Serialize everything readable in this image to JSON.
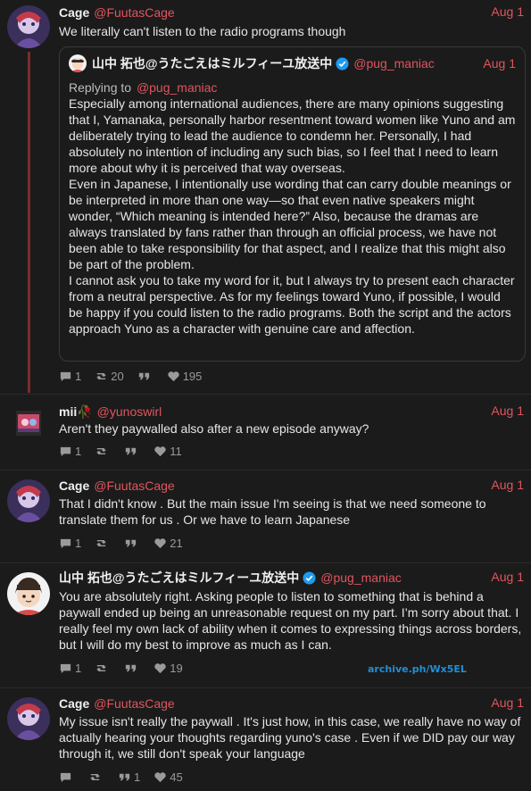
{
  "tweets": [
    {
      "name": "Cage",
      "handle": "@FuutasCage",
      "date": "Aug 1",
      "text": "We literally can't listen to the radio programs though",
      "stats": {
        "replies": "1",
        "retweets": "20",
        "quotes": "",
        "likes": "195"
      },
      "quote": {
        "name": "山中 拓也@うたごえはミルフィーユ放送中",
        "handle": "@pug_maniac",
        "date": "Aug 1",
        "replying_prefix": "Replying to",
        "replying_handle": "@pug_maniac",
        "paragraphs": [
          "Especially among international audiences, there are many opinions suggesting that I, Yamanaka, personally harbor resentment toward women like Yuno and am deliberately trying to lead the audience to condemn her. Personally, I had absolutely no intention of including any such bias, so I feel that I need to learn more about why it is perceived that way overseas.",
          "Even in Japanese, I intentionally use wording that can carry double meanings or be interpreted in more than one way—so that even native speakers might wonder, “Which meaning is intended here?” Also, because the dramas are always translated by fans rather than through an official process, we have not been able to take responsibility for that aspect, and I realize that this might also be part of the problem.",
          "I cannot ask you to take my word for it, but I always try to present each character from a neutral perspective. As for my feelings toward Yuno, if possible, I would be happy if you could listen to the radio programs. Both the script and the actors approach Yuno as a character with genuine care and affection."
        ]
      }
    },
    {
      "name": "mii🥀",
      "handle": "@yunoswirl",
      "date": "Aug 1",
      "text": "Aren't they paywalled also after a new episode anyway?",
      "stats": {
        "replies": "1",
        "retweets": "",
        "quotes": "",
        "likes": "11"
      }
    },
    {
      "name": "Cage",
      "handle": "@FuutasCage",
      "date": "Aug 1",
      "text": "That I didn't know . But the main issue I'm seeing is that we need someone to translate them for us . Or we have to learn Japanese",
      "stats": {
        "replies": "1",
        "retweets": "",
        "quotes": "",
        "likes": "21"
      }
    },
    {
      "name": "山中 拓也@うたごえはミルフィーユ放送中",
      "handle": "@pug_maniac",
      "date": "Aug 1",
      "text": "You are absolutely right. Asking people to listen to something that is behind a paywall ended up being an unreasonable request on my part. I’m sorry about that. I really feel my own lack of ability when it comes to expressing things across borders, but I will do my best to improve as much as I can.",
      "stats": {
        "replies": "1",
        "retweets": "",
        "quotes": "",
        "likes": "19"
      }
    },
    {
      "name": "Cage",
      "handle": "@FuutasCage",
      "date": "Aug 1",
      "text": "My issue isn't really the paywall . It's just how, in this case, we really have no way of actually hearing your thoughts regarding yuno's case . Even if we DID pay our way through it, we still don't speak your language",
      "stats": {
        "replies": "",
        "retweets": "",
        "quotes": "1",
        "likes": "45"
      }
    }
  ],
  "watermark": "archive.ph/Wx5EL",
  "colors": {
    "accent": "#e0555d",
    "background": "#1b1b1b",
    "thread_line": "#7a2e2e",
    "verified": "#1d9bf0",
    "watermark": "#1f8fd6"
  }
}
